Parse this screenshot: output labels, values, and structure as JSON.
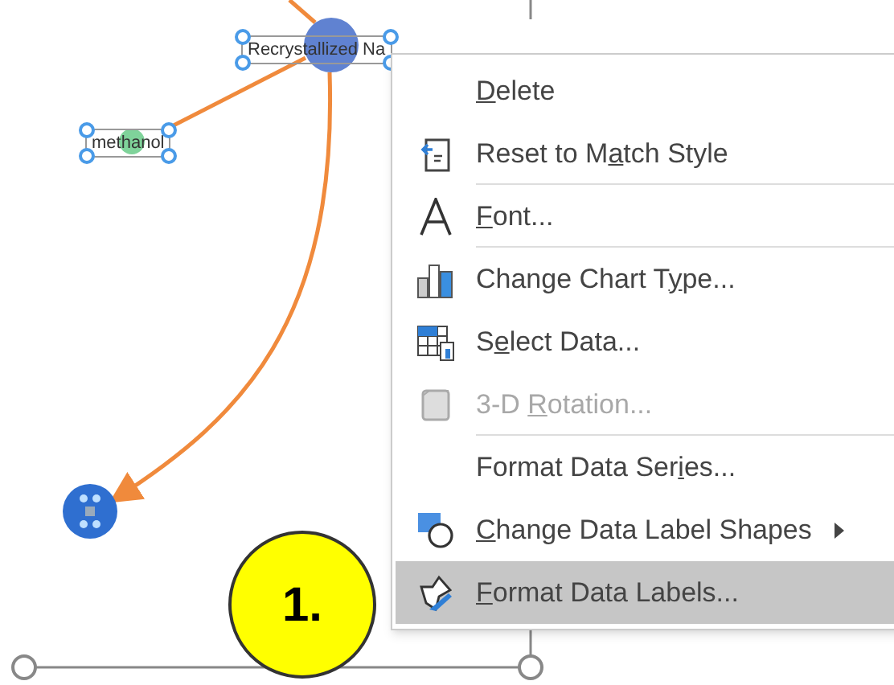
{
  "chart": {
    "labels": [
      {
        "text": "Recrystallized Na",
        "selected": true
      },
      {
        "text": "methanol",
        "selected": true
      }
    ]
  },
  "callout": {
    "text": "1."
  },
  "context_menu": {
    "items": [
      {
        "kind": "plain",
        "key": "D",
        "post": "elete",
        "disabled": false,
        "selected": false,
        "separator_after": false
      },
      {
        "kind": "reset",
        "pre": "Reset to M",
        "key": "a",
        "post": "tch Style",
        "disabled": false,
        "selected": false,
        "separator_after": true
      },
      {
        "kind": "font",
        "key": "F",
        "post": "ont...",
        "disabled": false,
        "selected": false,
        "separator_after": true
      },
      {
        "kind": "chart_type",
        "pre": "Change Chart T",
        "key": "y",
        "post": "pe...",
        "disabled": false,
        "selected": false,
        "separator_after": false
      },
      {
        "kind": "select_data",
        "pre": "S",
        "key": "e",
        "post": "lect Data...",
        "disabled": false,
        "selected": false,
        "separator_after": false
      },
      {
        "kind": "rotation",
        "pre": "3-D ",
        "key": "R",
        "post": "otation...",
        "disabled": true,
        "selected": false,
        "separator_after": true
      },
      {
        "kind": "plain",
        "pre": "Format Data Ser",
        "key": "i",
        "post": "es...",
        "disabled": false,
        "selected": false,
        "separator_after": false
      },
      {
        "kind": "label_shapes",
        "key": "C",
        "post": "hange Data Label Shapes",
        "disabled": false,
        "selected": false,
        "separator_after": false,
        "submenu": true
      },
      {
        "kind": "format_labels",
        "key": "F",
        "post": "ormat Data Labels...",
        "disabled": false,
        "selected": true,
        "separator_after": false
      }
    ]
  }
}
